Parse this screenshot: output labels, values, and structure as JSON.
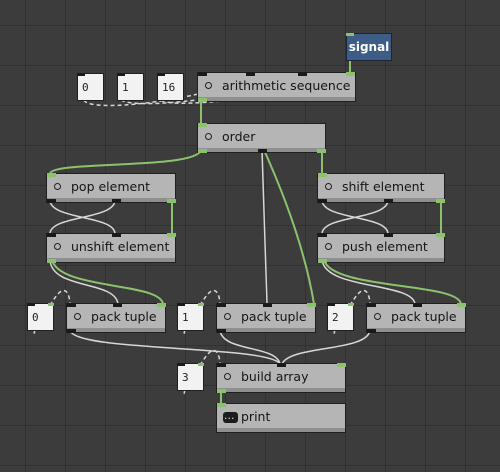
{
  "signal": {
    "label": "signal"
  },
  "number_boxes": {
    "start": "0",
    "step": "1",
    "count": "16",
    "tuple_left": "0",
    "tuple_mid": "1",
    "tuple_right": "2",
    "array_len": "3"
  },
  "nodes": {
    "arithmetic_sequence": "arithmetic sequence",
    "order": "order",
    "pop_element": "pop element",
    "unshift_element": "unshift element",
    "shift_element": "shift element",
    "push_element": "push element",
    "pack_tuple_left": "pack tuple",
    "pack_tuple_mid": "pack tuple",
    "pack_tuple_right": "pack tuple",
    "build_array": "build array",
    "print": "print"
  },
  "colors": {
    "background": "#3c3c3c",
    "node": "#b5b5b5",
    "signal": "#3d5d86",
    "active_port": "#8cc26e",
    "wire_control": "#8cc26e",
    "wire_data": "#d7d7d7"
  },
  "icons": {
    "node_inlet": "circle-icon",
    "print": "speech-bubble-icon"
  }
}
